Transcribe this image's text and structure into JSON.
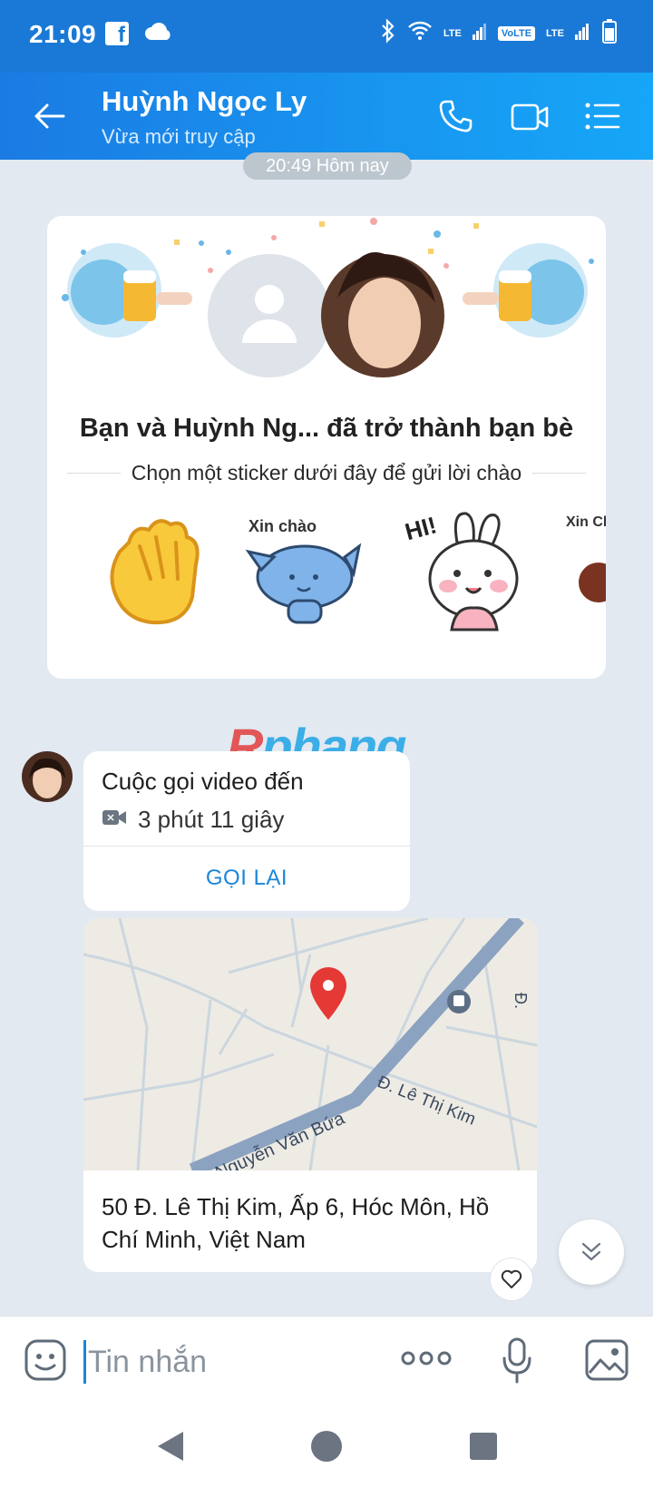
{
  "status_bar": {
    "time": "21:09",
    "network_lte": "LTE",
    "volte": "VoLTE",
    "network_lte2": "LTE",
    "icons": [
      "facebook-icon",
      "cloud-icon",
      "bluetooth-icon",
      "wifi-icon",
      "signal-icon",
      "battery-icon"
    ]
  },
  "header": {
    "contact_name": "Huỳnh Ngọc Ly",
    "contact_status": "Vừa mới truy cập",
    "icons": [
      "back-arrow-icon",
      "phone-icon",
      "video-call-icon",
      "menu-list-icon"
    ]
  },
  "conversation": {
    "timestamp": "20:49 Hôm nay",
    "friend_card": {
      "title": "Bạn và Huỳnh Ng...  đã trở thành bạn bè",
      "subtitle": "Chọn một sticker dưới đây để gửi lời chào",
      "stickers": [
        {
          "name": "waving-hand-sticker"
        },
        {
          "name": "xin-chao-cat-sticker",
          "text": "Xin chào"
        },
        {
          "name": "hi-bunny-sticker",
          "text": "HI!"
        },
        {
          "name": "xin-chao-partial-sticker",
          "text": "Xin Chà"
        }
      ]
    },
    "watermark": {
      "first": "R",
      "rest": "phang"
    },
    "call_message": {
      "title": "Cuộc gọi video đến",
      "duration": "3 phút 11 giây",
      "action": "GỌI LẠI"
    },
    "location_message": {
      "map_labels": {
        "street1": "Nguyễn Văn Bứa",
        "street2": "Đ. Lê Thị Kim",
        "street3": "Đ."
      },
      "address": "50 Đ. Lê Thị Kim, Ấp 6, Hóc Môn, Hồ Chí Minh, Việt Nam"
    }
  },
  "input_bar": {
    "placeholder": "Tin nhắn"
  },
  "colors": {
    "header_blue": "#1a86e8",
    "accent_link": "#1a86d8",
    "background": "#e2e9f1",
    "map_pin": "#e53935"
  }
}
